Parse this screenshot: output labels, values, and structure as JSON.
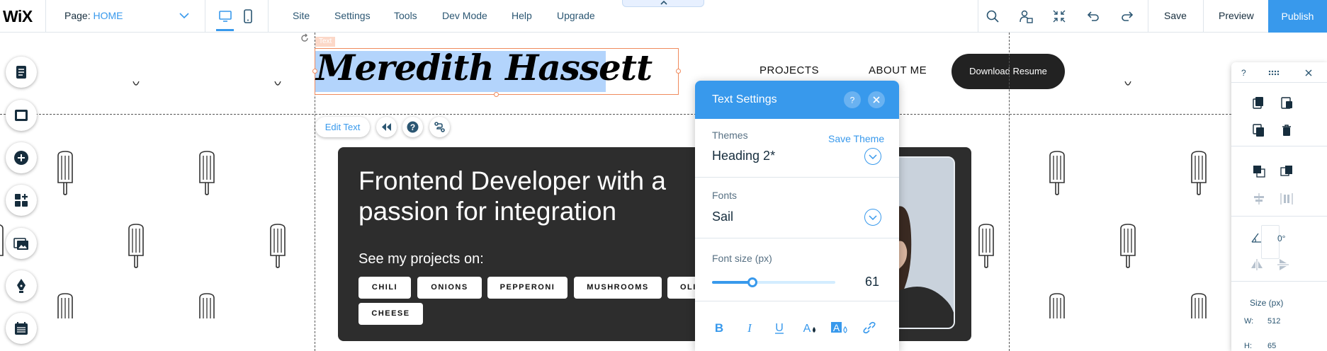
{
  "topbar": {
    "logo": "WiX",
    "page_label": "Page:",
    "page_value": "HOME",
    "menu": [
      "Site",
      "Settings",
      "Tools",
      "Dev Mode",
      "Help",
      "Upgrade"
    ],
    "save": "Save",
    "preview": "Preview",
    "publish": "Publish"
  },
  "canvas": {
    "element_label": "Text",
    "site_name": "Meredith Hassett",
    "nav": [
      "PROJECTS",
      "ABOUT ME"
    ],
    "download_resume": "Download Resume",
    "edit_text": "Edit Text",
    "headline": "Frontend Developer with a passion for integration",
    "see_projects": "See my projects on:",
    "tags": [
      "CHILI",
      "ONIONS",
      "PEPPERONI",
      "MUSHROOMS",
      "OLI",
      "CHEESE"
    ]
  },
  "text_settings": {
    "title": "Text Settings",
    "themes_label": "Themes",
    "save_theme": "Save Theme",
    "theme_value": "Heading 2*",
    "fonts_label": "Fonts",
    "font_value": "Sail",
    "size_label": "Font size (px)",
    "size_value": "61",
    "size_fraction": 0.33
  },
  "right_panel": {
    "help": "?",
    "angle": "0°",
    "size_label": "Size (px)",
    "w_label": "W:",
    "w_value": "512",
    "h_label": "H:",
    "h_value": "65"
  },
  "colors": {
    "accent": "#3899ec",
    "selection": "#f08a5d",
    "card": "#2d2d2d"
  }
}
